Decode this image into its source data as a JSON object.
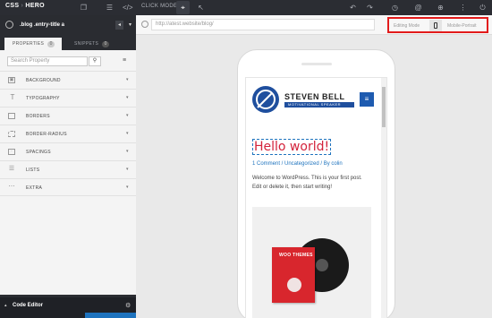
{
  "toolbar": {
    "logo_main": "CSS",
    "logo_sep": "",
    "logo_hero": "HERO",
    "click_mode": "CLICK MODE:",
    "icons": [
      "copy-icon",
      "list-icon",
      "code-icon",
      "cursor-icon",
      "undo-icon",
      "redo-icon",
      "history-icon",
      "at-icon",
      "globe-icon",
      "more-icon",
      "power-icon"
    ]
  },
  "selector": {
    "value": ".blog .entry-title a"
  },
  "tabs": [
    {
      "label": "PROPERTIES",
      "count": "0"
    },
    {
      "label": "SNIPPETS",
      "count": "0"
    }
  ],
  "search": {
    "placeholder": "Search Property"
  },
  "properties": [
    {
      "label": "BACKGROUND"
    },
    {
      "label": "TYPOGRAPHY"
    },
    {
      "label": "BORDERS"
    },
    {
      "label": "BORDER-RADIUS"
    },
    {
      "label": "SPACINGS"
    },
    {
      "label": "LISTS"
    },
    {
      "label": "EXTRA"
    }
  ],
  "code_editor": {
    "label": "Code Editor"
  },
  "urlbar": {
    "url": "http://atest.website/blog/",
    "editing_mode": "Editing Mode",
    "mobile_portrait": "Mobile-Portrait"
  },
  "site": {
    "brand_name": "STEVEN BELL",
    "brand_tagline": "MOTIVATIONAL SPEAKER",
    "post_title": "Hello world!",
    "post_meta": "1 Comment / Uncategorized / By colin",
    "post_body": "Welcome to WordPress. This is your first post. Edit or delete it, then start writing!",
    "sleeve_text": "WOO THEMES"
  },
  "colors": {
    "highlight": "#e21b1b",
    "accent": "#1e73be",
    "title": "#d3233b"
  }
}
